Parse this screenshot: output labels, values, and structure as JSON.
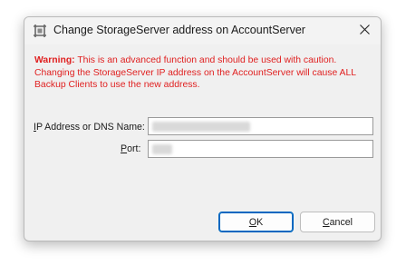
{
  "window": {
    "title": "Change StorageServer address on AccountServer",
    "icon": "server-gear-icon",
    "close_icon": "close-icon"
  },
  "warning": {
    "prefix": "Warning:",
    "text": " This is an advanced function and should be used with caution. Changing the StorageServer IP address on the AccountServer will cause ALL Backup Clients to use the new address.",
    "color": "#e02020"
  },
  "fields": {
    "ip_label_accel": "I",
    "ip_label_rest": "P Address or DNS Name:",
    "ip_value": "",
    "port_label_accel": "P",
    "port_label_rest": "ort:",
    "port_value": ""
  },
  "buttons": {
    "ok_accel": "O",
    "ok_rest": "K",
    "cancel_accel": "C",
    "cancel_rest": "ancel"
  },
  "colors": {
    "accent": "#0067c0",
    "dialog_bg": "#f0f0f0"
  }
}
